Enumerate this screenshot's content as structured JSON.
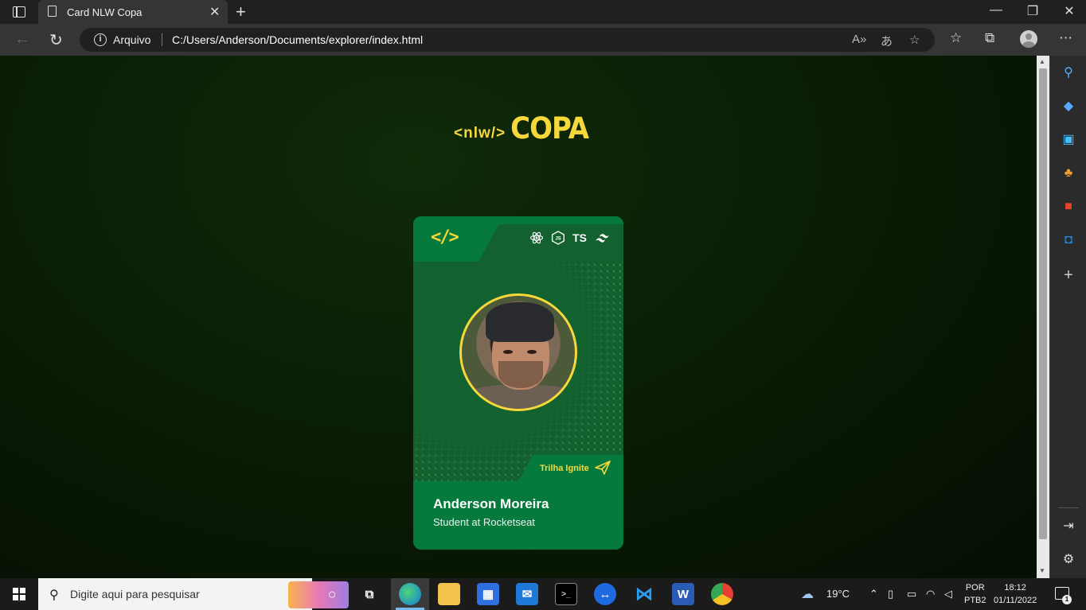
{
  "browser": {
    "tab_title": "Card NLW Copa",
    "address_prefix": "Arquivo",
    "url": "C:/Users/Anderson/Documents/explorer/index.html"
  },
  "page": {
    "logo_tag": "<nlw/>",
    "logo_word": "COPA",
    "card": {
      "code_symbol": "</>",
      "tech_ts": "TS",
      "trilha": "Trilha Ignite",
      "name": "Anderson Moreira",
      "role": "Student at Rocketseat"
    }
  },
  "taskbar": {
    "search_placeholder": "Digite aqui para pesquisar",
    "weather": "19°C",
    "lang_line1": "POR",
    "lang_line2": "PTB2",
    "time": "18:12",
    "date": "01/11/2022",
    "notification_count": "1"
  },
  "colors": {
    "brand_yellow": "#f7d83b",
    "card_green": "#057a3c",
    "card_dark_green": "#12612e"
  }
}
